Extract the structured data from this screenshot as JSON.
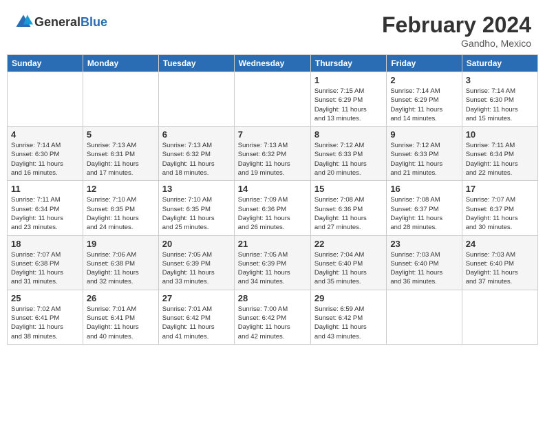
{
  "header": {
    "logo_general": "General",
    "logo_blue": "Blue",
    "month_year": "February 2024",
    "location": "Gandho, Mexico"
  },
  "weekdays": [
    "Sunday",
    "Monday",
    "Tuesday",
    "Wednesday",
    "Thursday",
    "Friday",
    "Saturday"
  ],
  "weeks": [
    [
      {
        "day": "",
        "info": ""
      },
      {
        "day": "",
        "info": ""
      },
      {
        "day": "",
        "info": ""
      },
      {
        "day": "",
        "info": ""
      },
      {
        "day": "1",
        "info": "Sunrise: 7:15 AM\nSunset: 6:29 PM\nDaylight: 11 hours\nand 13 minutes."
      },
      {
        "day": "2",
        "info": "Sunrise: 7:14 AM\nSunset: 6:29 PM\nDaylight: 11 hours\nand 14 minutes."
      },
      {
        "day": "3",
        "info": "Sunrise: 7:14 AM\nSunset: 6:30 PM\nDaylight: 11 hours\nand 15 minutes."
      }
    ],
    [
      {
        "day": "4",
        "info": "Sunrise: 7:14 AM\nSunset: 6:30 PM\nDaylight: 11 hours\nand 16 minutes."
      },
      {
        "day": "5",
        "info": "Sunrise: 7:13 AM\nSunset: 6:31 PM\nDaylight: 11 hours\nand 17 minutes."
      },
      {
        "day": "6",
        "info": "Sunrise: 7:13 AM\nSunset: 6:32 PM\nDaylight: 11 hours\nand 18 minutes."
      },
      {
        "day": "7",
        "info": "Sunrise: 7:13 AM\nSunset: 6:32 PM\nDaylight: 11 hours\nand 19 minutes."
      },
      {
        "day": "8",
        "info": "Sunrise: 7:12 AM\nSunset: 6:33 PM\nDaylight: 11 hours\nand 20 minutes."
      },
      {
        "day": "9",
        "info": "Sunrise: 7:12 AM\nSunset: 6:33 PM\nDaylight: 11 hours\nand 21 minutes."
      },
      {
        "day": "10",
        "info": "Sunrise: 7:11 AM\nSunset: 6:34 PM\nDaylight: 11 hours\nand 22 minutes."
      }
    ],
    [
      {
        "day": "11",
        "info": "Sunrise: 7:11 AM\nSunset: 6:34 PM\nDaylight: 11 hours\nand 23 minutes."
      },
      {
        "day": "12",
        "info": "Sunrise: 7:10 AM\nSunset: 6:35 PM\nDaylight: 11 hours\nand 24 minutes."
      },
      {
        "day": "13",
        "info": "Sunrise: 7:10 AM\nSunset: 6:35 PM\nDaylight: 11 hours\nand 25 minutes."
      },
      {
        "day": "14",
        "info": "Sunrise: 7:09 AM\nSunset: 6:36 PM\nDaylight: 11 hours\nand 26 minutes."
      },
      {
        "day": "15",
        "info": "Sunrise: 7:08 AM\nSunset: 6:36 PM\nDaylight: 11 hours\nand 27 minutes."
      },
      {
        "day": "16",
        "info": "Sunrise: 7:08 AM\nSunset: 6:37 PM\nDaylight: 11 hours\nand 28 minutes."
      },
      {
        "day": "17",
        "info": "Sunrise: 7:07 AM\nSunset: 6:37 PM\nDaylight: 11 hours\nand 30 minutes."
      }
    ],
    [
      {
        "day": "18",
        "info": "Sunrise: 7:07 AM\nSunset: 6:38 PM\nDaylight: 11 hours\nand 31 minutes."
      },
      {
        "day": "19",
        "info": "Sunrise: 7:06 AM\nSunset: 6:38 PM\nDaylight: 11 hours\nand 32 minutes."
      },
      {
        "day": "20",
        "info": "Sunrise: 7:05 AM\nSunset: 6:39 PM\nDaylight: 11 hours\nand 33 minutes."
      },
      {
        "day": "21",
        "info": "Sunrise: 7:05 AM\nSunset: 6:39 PM\nDaylight: 11 hours\nand 34 minutes."
      },
      {
        "day": "22",
        "info": "Sunrise: 7:04 AM\nSunset: 6:40 PM\nDaylight: 11 hours\nand 35 minutes."
      },
      {
        "day": "23",
        "info": "Sunrise: 7:03 AM\nSunset: 6:40 PM\nDaylight: 11 hours\nand 36 minutes."
      },
      {
        "day": "24",
        "info": "Sunrise: 7:03 AM\nSunset: 6:40 PM\nDaylight: 11 hours\nand 37 minutes."
      }
    ],
    [
      {
        "day": "25",
        "info": "Sunrise: 7:02 AM\nSunset: 6:41 PM\nDaylight: 11 hours\nand 38 minutes."
      },
      {
        "day": "26",
        "info": "Sunrise: 7:01 AM\nSunset: 6:41 PM\nDaylight: 11 hours\nand 40 minutes."
      },
      {
        "day": "27",
        "info": "Sunrise: 7:01 AM\nSunset: 6:42 PM\nDaylight: 11 hours\nand 41 minutes."
      },
      {
        "day": "28",
        "info": "Sunrise: 7:00 AM\nSunset: 6:42 PM\nDaylight: 11 hours\nand 42 minutes."
      },
      {
        "day": "29",
        "info": "Sunrise: 6:59 AM\nSunset: 6:42 PM\nDaylight: 11 hours\nand 43 minutes."
      },
      {
        "day": "",
        "info": ""
      },
      {
        "day": "",
        "info": ""
      }
    ]
  ]
}
